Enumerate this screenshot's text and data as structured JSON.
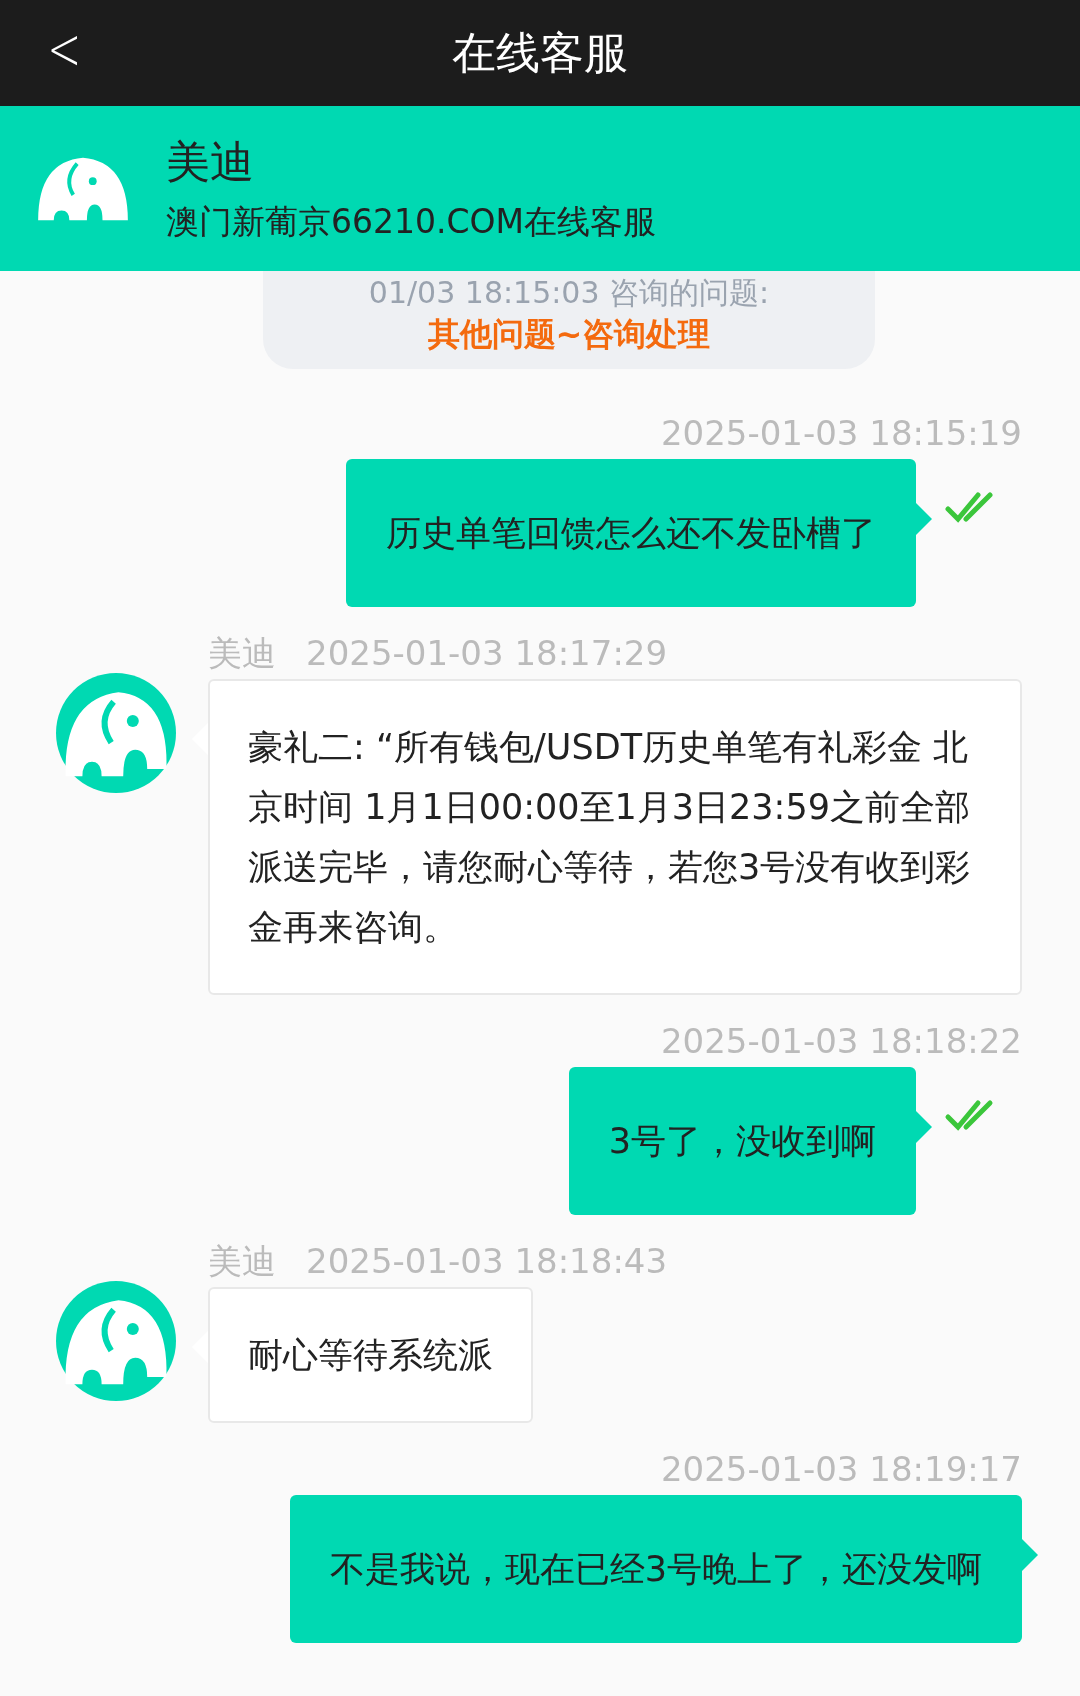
{
  "top_bar": {
    "back": "<",
    "title": "在线客服"
  },
  "agent": {
    "name": "美迪",
    "subtitle": "澳门新葡京66210.COM在线客服"
  },
  "inquiry": {
    "line": "01/03 18:15:03 咨询的问题:",
    "topic": "其他问题~咨询处理"
  },
  "messages": [
    {
      "kind": "sent",
      "time": "2025-01-03 18:15:19",
      "text": "历史单笔回馈怎么还不发卧槽了",
      "read": true
    },
    {
      "kind": "received",
      "sender": "美迪",
      "time": "2025-01-03 18:17:29",
      "text": "豪礼二: “所有钱包/USDT历史单笔有礼彩金 北京时间 1月1日00:00至1月3日23:59之前全部派送完毕，请您耐心等待，若您3号没有收到彩金再来咨询。"
    },
    {
      "kind": "sent",
      "time": "2025-01-03 18:18:22",
      "text": "3号了，没收到啊",
      "read": true
    },
    {
      "kind": "received",
      "sender": "美迪",
      "time": "2025-01-03 18:18:43",
      "text": "耐心等待系统派"
    },
    {
      "kind": "sent",
      "time": "2025-01-03 18:19:17",
      "text": "不是我说，现在已经3号晚上了，还没发啊",
      "read": false
    }
  ]
}
